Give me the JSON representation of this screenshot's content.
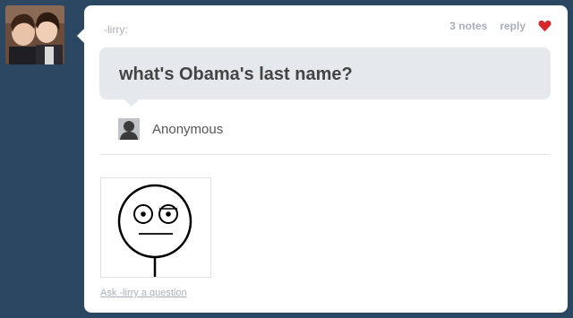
{
  "post": {
    "username": "-lirry:",
    "notes": "3 notes",
    "reply_label": "reply",
    "question": "what's Obama's last name?",
    "asker_name": "Anonymous",
    "ask_link": "Ask -lirry a question"
  },
  "icons": {
    "heart": "heart-icon",
    "asker_avatar": "anonymous-avatar-icon"
  },
  "colors": {
    "background": "#2c4762",
    "heart": "#d9262b",
    "question_bg": "#e5e9ed"
  }
}
